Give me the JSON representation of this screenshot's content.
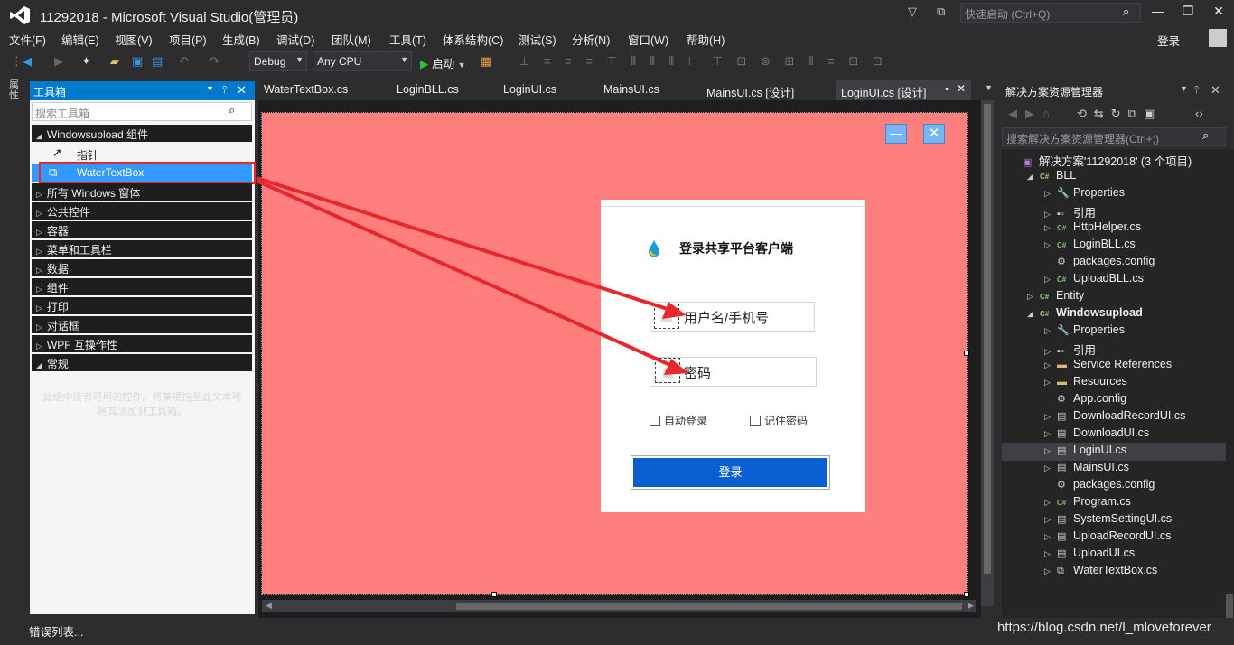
{
  "window": {
    "title": "11292018 - Microsoft Visual Studio(管理员)",
    "quick_launch_placeholder": "快速启动 (Ctrl+Q)",
    "login_label": "登录"
  },
  "menu": [
    "文件(F)",
    "编辑(E)",
    "视图(V)",
    "项目(P)",
    "生成(B)",
    "调试(D)",
    "团队(M)",
    "工具(T)",
    "体系结构(C)",
    "测试(S)",
    "分析(N)",
    "窗口(W)",
    "帮助(H)"
  ],
  "toolbar": {
    "config": "Debug",
    "platform": "Any CPU",
    "start_label": "启动"
  },
  "left_strip": {
    "tab_label": "属性"
  },
  "toolbox": {
    "title": "工具箱",
    "search_placeholder": "搜索工具箱",
    "group_label": "Windowsupload 组件",
    "pointer_label": "指针",
    "custom_item": "WaterTextBox",
    "categories": [
      "所有 Windows 窗体",
      "公共控件",
      "容器",
      "菜单和工具栏",
      "数据",
      "组件",
      "打印",
      "对话框",
      "WPF 互操作性"
    ],
    "general_label": "常规",
    "empty_message": "此组中没有可用的控件。将某项拖至此文本可将其添加到工具箱。"
  },
  "editor_tabs": [
    {
      "label": "WaterTextBox.cs",
      "active": false
    },
    {
      "label": "LoginBLL.cs",
      "active": false
    },
    {
      "label": "LoginUI.cs",
      "active": false
    },
    {
      "label": "MainsUI.cs",
      "active": false
    },
    {
      "label": "MainsUI.cs [设计]",
      "active": false
    },
    {
      "label": "LoginUI.cs [设计]",
      "active": true
    }
  ],
  "designer": {
    "form_color": "#ff7f7f",
    "minimize_glyph": "—",
    "close_glyph": "✕",
    "login_title": "登录共享平台客户端",
    "username_placeholder": "用户名/手机号",
    "password_placeholder": "密码",
    "auto_login": "自动登录",
    "remember_password": "记住密码",
    "login_button": "登录",
    "button_color": "#0a5fd0"
  },
  "solution_explorer": {
    "title": "解决方案资源管理器",
    "search_placeholder": "搜索解决方案资源管理器(Ctrl+;)",
    "nodes": [
      {
        "label": "解决方案'11292018' (3 个项目)",
        "icon": "solution-icon",
        "level": 0,
        "expander": ""
      },
      {
        "label": "BLL",
        "icon": "csharp-project-icon",
        "level": 1,
        "expander": "expanded"
      },
      {
        "label": "Properties",
        "icon": "wrench-icon",
        "level": 2,
        "expander": "collapsed"
      },
      {
        "label": "引用",
        "icon": "references-icon",
        "level": 2,
        "expander": "collapsed"
      },
      {
        "label": "HttpHelper.cs",
        "icon": "csharp-file-icon",
        "level": 2,
        "expander": "collapsed"
      },
      {
        "label": "LoginBLL.cs",
        "icon": "csharp-file-icon",
        "level": 2,
        "expander": "collapsed"
      },
      {
        "label": "packages.config",
        "icon": "config-icon",
        "level": 2,
        "expander": ""
      },
      {
        "label": "UploadBLL.cs",
        "icon": "csharp-file-icon",
        "level": 2,
        "expander": "collapsed"
      },
      {
        "label": "Entity",
        "icon": "csharp-project-icon",
        "level": 1,
        "expander": "collapsed"
      },
      {
        "label": "Windowsupload",
        "icon": "csharp-project-icon",
        "level": 1,
        "expander": "expanded",
        "bold": true
      },
      {
        "label": "Properties",
        "icon": "wrench-icon",
        "level": 2,
        "expander": "collapsed"
      },
      {
        "label": "引用",
        "icon": "references-icon",
        "level": 2,
        "expander": "collapsed"
      },
      {
        "label": "Service References",
        "icon": "folder-icon",
        "level": 2,
        "expander": "collapsed"
      },
      {
        "label": "Resources",
        "icon": "folder-icon",
        "level": 2,
        "expander": "collapsed"
      },
      {
        "label": "App.config",
        "icon": "config-icon",
        "level": 2,
        "expander": ""
      },
      {
        "label": "DownloadRecordUI.cs",
        "icon": "form-icon",
        "level": 2,
        "expander": "collapsed"
      },
      {
        "label": "DownloadUI.cs",
        "icon": "form-icon",
        "level": 2,
        "expander": "collapsed"
      },
      {
        "label": "LoginUI.cs",
        "icon": "form-icon",
        "level": 2,
        "expander": "collapsed",
        "selected": true
      },
      {
        "label": "MainsUI.cs",
        "icon": "form-icon",
        "level": 2,
        "expander": "collapsed"
      },
      {
        "label": "packages.config",
        "icon": "config-icon",
        "level": 2,
        "expander": ""
      },
      {
        "label": "Program.cs",
        "icon": "csharp-file-icon",
        "level": 2,
        "expander": "collapsed"
      },
      {
        "label": "SystemSettingUI.cs",
        "icon": "form-icon",
        "level": 2,
        "expander": "collapsed"
      },
      {
        "label": "UploadRecordUI.cs",
        "icon": "form-icon",
        "level": 2,
        "expander": "collapsed"
      },
      {
        "label": "UploadUI.cs",
        "icon": "form-icon",
        "level": 2,
        "expander": "collapsed"
      },
      {
        "label": "WaterTextBox.cs",
        "icon": "component-icon",
        "level": 2,
        "expander": "collapsed"
      }
    ]
  },
  "status": {
    "left_text": "错误列表...",
    "watermark": "https://blog.csdn.net/l_mloveforever"
  },
  "colors": {
    "accent": "#007acc",
    "annotation_red": "#e8262d",
    "selection": "#3399ff"
  }
}
